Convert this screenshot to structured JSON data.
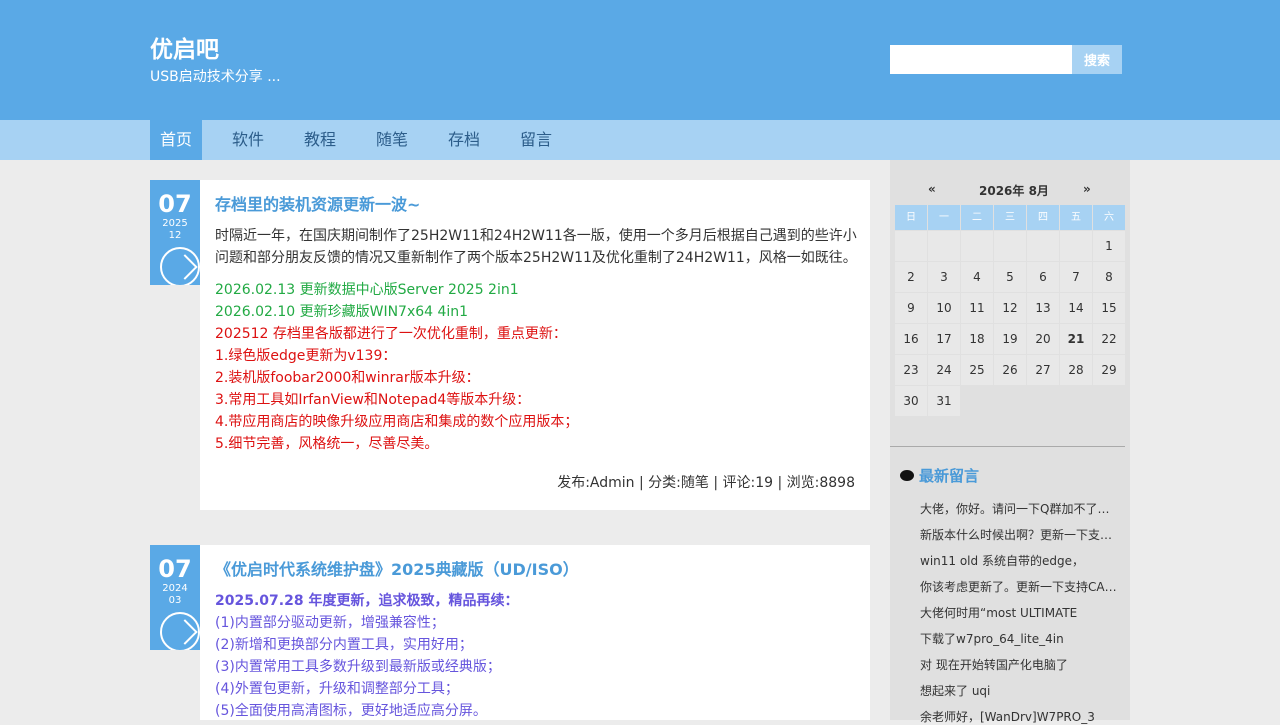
{
  "site": {
    "title": "优启吧",
    "subtitle": "USB启动技术分享 ..."
  },
  "search": {
    "button_label": "搜索",
    "value": ""
  },
  "nav": {
    "items": [
      {
        "label": "首页",
        "active": true
      },
      {
        "label": "软件"
      },
      {
        "label": "教程"
      },
      {
        "label": "随笔"
      },
      {
        "label": "存档"
      },
      {
        "label": "留言"
      }
    ]
  },
  "posts": [
    {
      "day": "07",
      "year": "2025",
      "month": "12",
      "title": "存档里的装机资源更新一波~",
      "intro": [
        "时隔近一年，在国庆期间制作了25H2W11和24H2W11各一版，使用一个多月后根据自己遇到的些许小",
        "问题和部分朋友反馈的情况又重新制作了两个版本25H2W11及优化重制了24H2W11，风格一如既往。"
      ],
      "updates_green": [
        "2026.02.13 更新数据中心版Server 2025 2in1",
        "2026.02.10 更新珍藏版WIN7x64 4in1"
      ],
      "updates_red": [
        "202512 存档里各版都进行了一次优化重制，重点更新：",
        "1.绿色版edge更新为v139：",
        "2.装机版foobar2000和winrar版本升级：",
        "3.常用工具如IrfanView和Notepad4等版本升级：",
        "4.带应用商店的映像升级应用商店和集成的数个应用版本；",
        "5.细节完善，风格统一，尽善尽美。"
      ],
      "meta": "发布:Admin | 分类:随笔 | 评论:19 | 浏览:8898"
    },
    {
      "day": "07",
      "year": "2024",
      "month": "03",
      "title": "《优启时代系统维护盘》2025典藏版（UD/ISO）",
      "headline": "2025.07.28 年度更新，追求极致，精品再续：",
      "items": [
        "(1)内置部分驱动更新，增强兼容性；",
        "(2)新增和更换部分内置工具，实用好用；",
        "(3)内置常用工具多数升级到最新版或经典版；",
        "(4)外置包更新，升级和调整部分工具；",
        "(5)全面使用高清图标，更好地适应高分屏。"
      ]
    }
  ],
  "calendar": {
    "prev": "«",
    "title": "2026年 8月",
    "next": "»",
    "weekdays": [
      "日",
      "一",
      "二",
      "三",
      "四",
      "五",
      "六"
    ],
    "first_weekday": 6,
    "days": 31,
    "today": 21
  },
  "comments": {
    "title": "最新留言",
    "icon": "speech-bubble-icon",
    "items": [
      "大佬，你好。请问一下Q群加不了了吗？",
      "新版本什么时候出啊？更新一下支持新硬件",
      "win11 old 系统自带的edge，",
      "你该考虑更新了。更新一下支持CAB驱动",
      "大佬何时用“most ULTIMATE",
      "下载了w7pro_64_lite_4in",
      "对 现在开始转国产化电脑了",
      "想起来了 uqi",
      "余老师好，[WanDrv]W7PRO_3"
    ]
  },
  "colors": {
    "header": "#5aa9e6",
    "nav": "#a7d2f3",
    "accent": "#4a9ad8"
  }
}
